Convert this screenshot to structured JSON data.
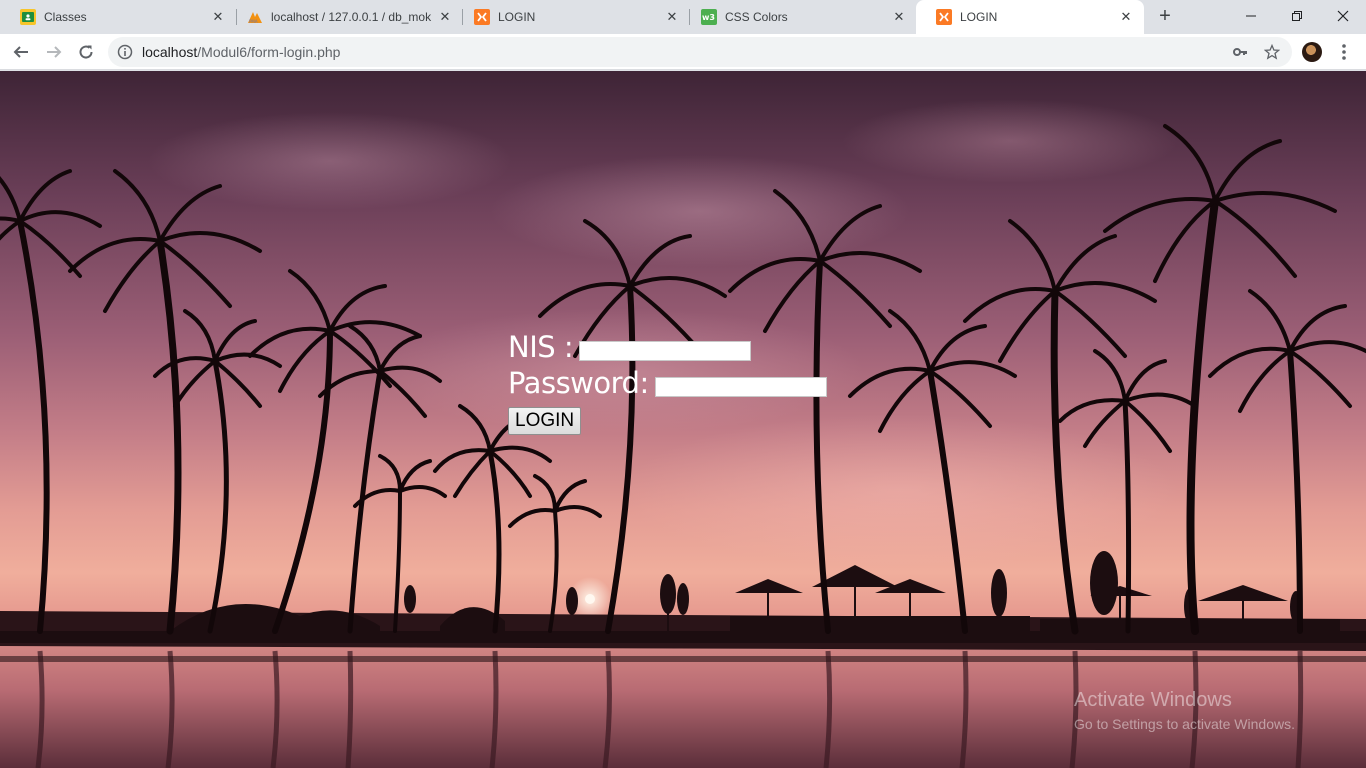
{
  "browser": {
    "tabs": [
      {
        "title": "Classes",
        "icon": "google-classroom-icon",
        "active": false
      },
      {
        "title": "localhost / 127.0.0.1 / db_mok",
        "icon": "phpmyadmin-icon",
        "active": false
      },
      {
        "title": "LOGIN",
        "icon": "xampp-icon",
        "active": false
      },
      {
        "title": "CSS Colors",
        "icon": "w3schools-icon",
        "active": false
      },
      {
        "title": "LOGIN",
        "icon": "xampp-icon",
        "active": true
      }
    ],
    "new_tab_label": "+",
    "window_controls": {
      "minimize": "—",
      "restore": "❐",
      "close": "✕"
    },
    "url_host": "localhost",
    "url_path": "/Modul6/form-login.php"
  },
  "form": {
    "nis_label": "NIS :",
    "nis_value": "",
    "password_label": "Password:",
    "password_value": "",
    "login_button": "LOGIN"
  },
  "watermark": {
    "line1": "Activate Windows",
    "line2": "Go to Settings to activate Windows."
  },
  "colors": {
    "tabstrip": "#dee1e6",
    "toolbar": "#ffffff",
    "omnibox": "#f1f3f4",
    "xampp_orange": "#fb7a24"
  }
}
